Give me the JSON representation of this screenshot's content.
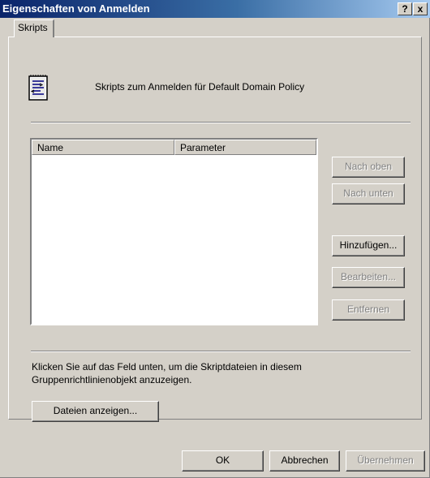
{
  "window": {
    "title": "Eigenschaften von Anmelden",
    "help_button": "?",
    "close_button": "x"
  },
  "tabs": [
    {
      "label": "Skripts"
    }
  ],
  "header": {
    "icon": "script-file-icon",
    "text": "Skripts zum Anmelden für Default Domain Policy"
  },
  "list": {
    "columns": [
      "Name",
      "Parameter"
    ],
    "rows": []
  },
  "side_buttons": {
    "up": {
      "label": "Nach oben",
      "enabled": false
    },
    "down": {
      "label": "Nach unten",
      "enabled": false
    },
    "add": {
      "label": "Hinzufügen...",
      "enabled": true
    },
    "edit": {
      "label": "Bearbeiten...",
      "enabled": false
    },
    "remove": {
      "label": "Entfernen",
      "enabled": false
    }
  },
  "info": {
    "text": "Klicken Sie auf das Feld unten, um die Skriptdateien in diesem Gruppenrichtlinienobjekt anzuzeigen."
  },
  "show_files_button": {
    "label": "Dateien anzeigen..."
  },
  "footer": {
    "ok": {
      "label": "OK",
      "enabled": true
    },
    "cancel": {
      "label": "Abbrechen",
      "enabled": true
    },
    "apply": {
      "label": "Übernehmen",
      "enabled": false
    }
  },
  "colors": {
    "titlebar_start": "#0a246a",
    "titlebar_end": "#a6caf0",
    "face": "#d4d0c8"
  }
}
